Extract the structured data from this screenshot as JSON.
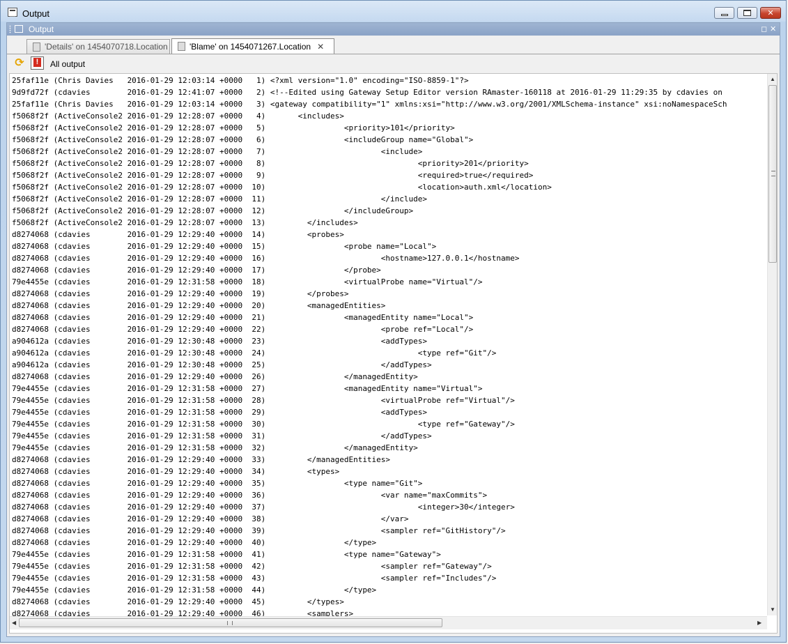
{
  "window": {
    "title": "Output"
  },
  "panel": {
    "title": "Output"
  },
  "tabs": [
    {
      "label": "'Details' on 1454070718.Location",
      "close": "✕"
    },
    {
      "label": "'Blame' on 1454071267.Location",
      "close": "✕"
    }
  ],
  "toolbar": {
    "all_output_label": "All output"
  },
  "lines": [
    "25faf11e (Chris Davies   2016-01-29 12:03:14 +0000   1) <?xml version=\"1.0\" encoding=\"ISO-8859-1\"?>",
    "9d9fd72f (cdavies        2016-01-29 12:41:07 +0000   2) <!--Edited using Gateway Setup Editor version RAmaster-160118 at 2016-01-29 11:29:35 by cdavies on",
    "25faf11e (Chris Davies   2016-01-29 12:03:14 +0000   3) <gateway compatibility=\"1\" xmlns:xsi=\"http://www.w3.org/2001/XMLSchema-instance\" xsi:noNamespaceSch",
    "f5068f2f (ActiveConsole2 2016-01-29 12:28:07 +0000   4)       <includes>",
    "f5068f2f (ActiveConsole2 2016-01-29 12:28:07 +0000   5)                 <priority>101</priority>",
    "f5068f2f (ActiveConsole2 2016-01-29 12:28:07 +0000   6)                 <includeGroup name=\"Global\">",
    "f5068f2f (ActiveConsole2 2016-01-29 12:28:07 +0000   7)                         <include>",
    "f5068f2f (ActiveConsole2 2016-01-29 12:28:07 +0000   8)                                 <priority>201</priority>",
    "f5068f2f (ActiveConsole2 2016-01-29 12:28:07 +0000   9)                                 <required>true</required>",
    "f5068f2f (ActiveConsole2 2016-01-29 12:28:07 +0000  10)                                 <location>auth.xml</location>",
    "f5068f2f (ActiveConsole2 2016-01-29 12:28:07 +0000  11)                         </include>",
    "f5068f2f (ActiveConsole2 2016-01-29 12:28:07 +0000  12)                 </includeGroup>",
    "f5068f2f (ActiveConsole2 2016-01-29 12:28:07 +0000  13)         </includes>",
    "d8274068 (cdavies        2016-01-29 12:29:40 +0000  14)         <probes>",
    "d8274068 (cdavies        2016-01-29 12:29:40 +0000  15)                 <probe name=\"Local\">",
    "d8274068 (cdavies        2016-01-29 12:29:40 +0000  16)                         <hostname>127.0.0.1</hostname>",
    "d8274068 (cdavies        2016-01-29 12:29:40 +0000  17)                 </probe>",
    "79e4455e (cdavies        2016-01-29 12:31:58 +0000  18)                 <virtualProbe name=\"Virtual\"/>",
    "d8274068 (cdavies        2016-01-29 12:29:40 +0000  19)         </probes>",
    "d8274068 (cdavies        2016-01-29 12:29:40 +0000  20)         <managedEntities>",
    "d8274068 (cdavies        2016-01-29 12:29:40 +0000  21)                 <managedEntity name=\"Local\">",
    "d8274068 (cdavies        2016-01-29 12:29:40 +0000  22)                         <probe ref=\"Local\"/>",
    "a904612a (cdavies        2016-01-29 12:30:48 +0000  23)                         <addTypes>",
    "a904612a (cdavies        2016-01-29 12:30:48 +0000  24)                                 <type ref=\"Git\"/>",
    "a904612a (cdavies        2016-01-29 12:30:48 +0000  25)                         </addTypes>",
    "d8274068 (cdavies        2016-01-29 12:29:40 +0000  26)                 </managedEntity>",
    "79e4455e (cdavies        2016-01-29 12:31:58 +0000  27)                 <managedEntity name=\"Virtual\">",
    "79e4455e (cdavies        2016-01-29 12:31:58 +0000  28)                         <virtualProbe ref=\"Virtual\"/>",
    "79e4455e (cdavies        2016-01-29 12:31:58 +0000  29)                         <addTypes>",
    "79e4455e (cdavies        2016-01-29 12:31:58 +0000  30)                                 <type ref=\"Gateway\"/>",
    "79e4455e (cdavies        2016-01-29 12:31:58 +0000  31)                         </addTypes>",
    "79e4455e (cdavies        2016-01-29 12:31:58 +0000  32)                 </managedEntity>",
    "d8274068 (cdavies        2016-01-29 12:29:40 +0000  33)         </managedEntities>",
    "d8274068 (cdavies        2016-01-29 12:29:40 +0000  34)         <types>",
    "d8274068 (cdavies        2016-01-29 12:29:40 +0000  35)                 <type name=\"Git\">",
    "d8274068 (cdavies        2016-01-29 12:29:40 +0000  36)                         <var name=\"maxCommits\">",
    "d8274068 (cdavies        2016-01-29 12:29:40 +0000  37)                                 <integer>30</integer>",
    "d8274068 (cdavies        2016-01-29 12:29:40 +0000  38)                         </var>",
    "d8274068 (cdavies        2016-01-29 12:29:40 +0000  39)                         <sampler ref=\"GitHistory\"/>",
    "d8274068 (cdavies        2016-01-29 12:29:40 +0000  40)                 </type>",
    "79e4455e (cdavies        2016-01-29 12:31:58 +0000  41)                 <type name=\"Gateway\">",
    "79e4455e (cdavies        2016-01-29 12:31:58 +0000  42)                         <sampler ref=\"Gateway\"/>",
    "79e4455e (cdavies        2016-01-29 12:31:58 +0000  43)                         <sampler ref=\"Includes\"/>",
    "79e4455e (cdavies        2016-01-29 12:31:58 +0000  44)                 </type>",
    "d8274068 (cdavies        2016-01-29 12:29:40 +0000  45)         </types>",
    "d8274068 (cdavies        2016-01-29 12:29:40 +0000  46)         <samplers>"
  ]
}
